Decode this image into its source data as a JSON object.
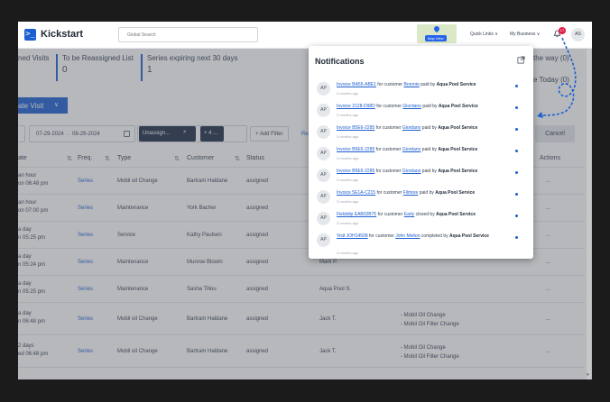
{
  "app": {
    "logo_glyph": ">_",
    "name": "Kickstart"
  },
  "topbar": {
    "search_placeholder": "Global Search",
    "map_view_label": "Map View",
    "quick_links": "Quick Links ∨",
    "my_business": "My Business ∨",
    "notif_count": "17",
    "user_initials": "AS"
  },
  "cards": [
    {
      "label": "ned Visits",
      "value": ""
    },
    {
      "label": "To be Reassigned List",
      "value": "0"
    },
    {
      "label": "Series expiring next 30 days",
      "value": "1"
    },
    {
      "label": "the way",
      "value": "(0)"
    },
    {
      "label": "e Today",
      "value": "(0)"
    }
  ],
  "create_visit": {
    "label": "ate Visit",
    "chevron": "∨"
  },
  "filters": {
    "date_from": "07-29-2024",
    "arrow": "→",
    "date_to": "08-29-2024",
    "chip": "Unassign...",
    "chip_close": "×",
    "chip_more": "+ 4 ...",
    "add_filter": "+ Add Filter",
    "reset_fragment": "Re",
    "cancel": "Cancel"
  },
  "table": {
    "headers": [
      "ate",
      "Freq.",
      "Type",
      "Customer",
      "Status",
      "Actions"
    ],
    "rows": [
      {
        "date1": "an hour",
        "date2": "on 06:48 pm",
        "freq": "Series",
        "type": "Mobil oil Change",
        "customer": "Bartram Haldane",
        "status": "assigned",
        "tech": "",
        "items": [],
        "actions": "..."
      },
      {
        "date1": "an hour",
        "date2": "on 07:00 pm",
        "freq": "Series",
        "type": "Maintenance",
        "customer": "York Bacher",
        "status": "assigned",
        "tech": "",
        "items": [],
        "actions": "..."
      },
      {
        "date1": "a day",
        "date2": "n 05:25 pm",
        "freq": "Series",
        "type": "Service",
        "customer": "Kathy Paulsen",
        "status": "assigned",
        "tech": "",
        "items": [],
        "actions": "..."
      },
      {
        "date1": "a day",
        "date2": "n 05:24 pm",
        "freq": "Series",
        "type": "Maintenance",
        "customer": "Munroe Blowin",
        "status": "assigned",
        "tech": "Mark P.",
        "items": [],
        "actions": "..."
      },
      {
        "date1": "a day",
        "date2": "n 05:25 pm",
        "freq": "Series",
        "type": "Maintenance",
        "customer": "Sasha Tillou",
        "status": "assigned",
        "tech": "Aqua Pool S.",
        "items": [],
        "actions": "..."
      },
      {
        "date1": "a day",
        "date2": "n 06:48 pm",
        "freq": "Series",
        "type": "Mobil oil Change",
        "customer": "Bartram Haldane",
        "status": "assigned",
        "tech": "Jack T.",
        "items": [
          "- Mobil Oil Change",
          "- Mobil Oil Filter Change"
        ],
        "actions": "..."
      },
      {
        "date1": "2 days",
        "date2": "ed 06:48 pm",
        "freq": "Series",
        "type": "Mobil oil Change",
        "customer": "Bartram Haldane",
        "status": "assigned",
        "tech": "Jack T.",
        "items": [
          "- Mobil Oil Change",
          "- Mobil Oil Filter Change"
        ],
        "actions": "..."
      }
    ]
  },
  "notifications": {
    "title": "Notifications",
    "items": [
      {
        "initials": "AP",
        "link": "Invoice BA55-ABE1",
        "mid": " for customer ",
        "customer": "Bronnie",
        "tail": " paid by ",
        "by": "Aqua Pool Service",
        "ago": "3 months ago"
      },
      {
        "initials": "AP",
        "link": "Invoice 2128-D98D",
        "mid": " for customer ",
        "customer": "Giordano",
        "tail": " paid by ",
        "by": "Aqua Pool Service",
        "ago": "3 months ago"
      },
      {
        "initials": "AP",
        "link": "Invoice B5E6-2285",
        "mid": " for customer ",
        "customer": "Giordano",
        "tail": " paid by ",
        "by": "Aqua Pool Service",
        "ago": "3 months ago"
      },
      {
        "initials": "AP",
        "link": "Invoice B5E6-2285",
        "mid": " for customer ",
        "customer": "Giordano",
        "tail": " paid by ",
        "by": "Aqua Pool Service",
        "ago": "3 months ago"
      },
      {
        "initials": "AP",
        "link": "Invoice B5E6-2285",
        "mid": " for customer ",
        "customer": "Giordano",
        "tail": " paid by ",
        "by": "Aqua Pool Service",
        "ago": "3 months ago"
      },
      {
        "initials": "AP",
        "link": "Invoice 5E1A-C215",
        "mid": " for customer ",
        "customer": "Filmore",
        "tail": " paid by ",
        "by": "Aqua Pool Service",
        "ago": "3 months ago"
      },
      {
        "initials": "AP",
        "link": "Fieldslip EAB02B75",
        "mid": " for customer ",
        "customer": "Early",
        "tail": " closed by ",
        "by": "Aqua Pool Service",
        "ago": "3 months ago"
      },
      {
        "initials": "AP",
        "link": "Visit JOH14508",
        "mid": " for customer ",
        "customer": "John Melton",
        "tail": " completed by ",
        "by": "Aqua Pool Service",
        "ago": "3 months ago"
      }
    ]
  },
  "scrollbar": {
    "down_arrow": "▾"
  },
  "colors": {
    "brand": "#1d5fd1",
    "badge": "#e11d48",
    "chip": "#1f2d48",
    "annotation": "#1d5fd1"
  }
}
